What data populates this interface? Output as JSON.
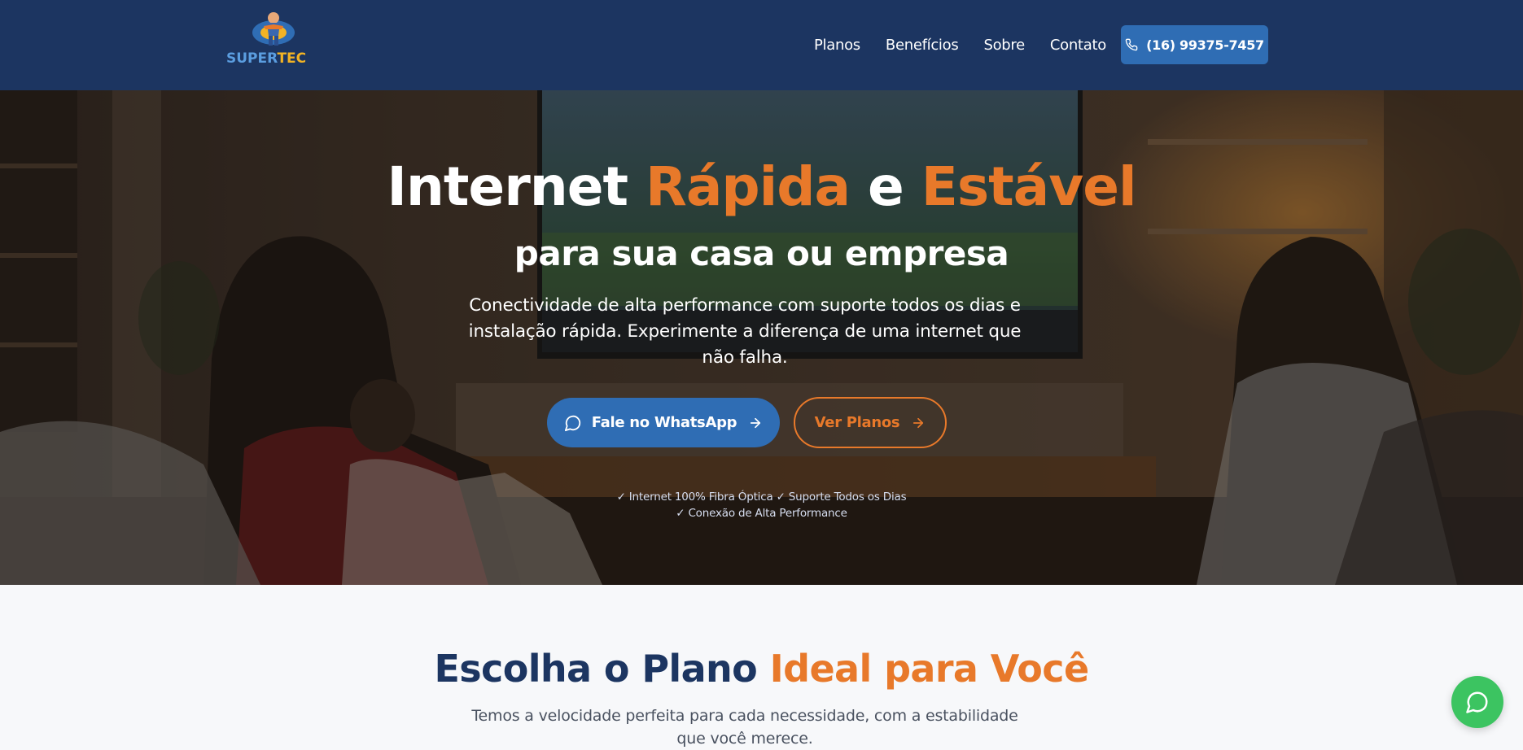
{
  "brand": {
    "logo_part1": "SUPER",
    "logo_part2": "TEC"
  },
  "nav": {
    "items": [
      "Planos",
      "Benefícios",
      "Sobre",
      "Contato"
    ],
    "phone_label": "(16) 99375-7457"
  },
  "hero": {
    "title_1": "Internet ",
    "title_2": "Rápida",
    "title_3": " e ",
    "title_4": "Estável",
    "subtitle": "para sua casa ou empresa",
    "description": "Conectividade de alta performance com suporte todos os dias e instalação rápida. Experimente a diferença de uma internet que não falha.",
    "cta_primary": "Fale no WhatsApp",
    "cta_secondary": "Ver Planos",
    "features_line1": "✓ Internet 100% Fibra Óptica ✓ Suporte Todos os Dias",
    "features_line2": "✓ Conexão de Alta Performance"
  },
  "plans": {
    "title_1": "Escolha o Plano ",
    "title_2": "Ideal para Você",
    "description": "Temos a velocidade perfeita para cada necessidade, com a estabilidade que você merece."
  },
  "icons": {
    "phone": "phone-icon",
    "chat": "chat-bubble-icon",
    "arrow": "arrow-right-icon",
    "whatsapp": "whatsapp-icon"
  },
  "colors": {
    "navy": "#1c3561",
    "primary_blue": "#2f6db4",
    "accent_orange": "#e8792a",
    "whatsapp_green": "#3cc461"
  }
}
